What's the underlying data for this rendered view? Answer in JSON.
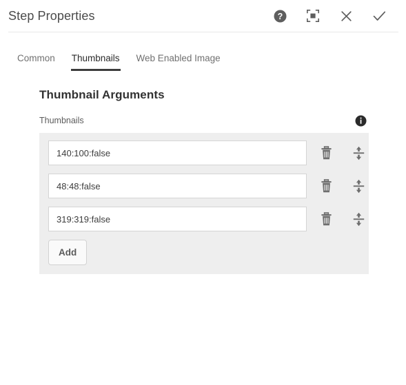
{
  "header": {
    "title": "Step Properties",
    "actions": [
      {
        "name": "help-icon",
        "label": "Help"
      },
      {
        "name": "fullscreen-icon",
        "label": "Fullscreen"
      },
      {
        "name": "close-icon",
        "label": "Close"
      },
      {
        "name": "confirm-check-icon",
        "label": "Done"
      }
    ]
  },
  "tabs": [
    {
      "label": "Common",
      "active": false
    },
    {
      "label": "Thumbnails",
      "active": true
    },
    {
      "label": "Web Enabled Image",
      "active": false
    }
  ],
  "main": {
    "section_title": "Thumbnail Arguments",
    "field": {
      "label": "Thumbnails",
      "info_icon": "info-icon",
      "rows": [
        {
          "value": "140:100:false",
          "delete_icon": "trash-icon",
          "drag_icon": "drag-handle-icon"
        },
        {
          "value": "48:48:false",
          "delete_icon": "trash-icon",
          "drag_icon": "drag-handle-icon"
        },
        {
          "value": "319:319:false",
          "delete_icon": "trash-icon",
          "drag_icon": "drag-handle-icon"
        }
      ],
      "add_label": "Add"
    }
  },
  "colors": {
    "panel_bg": "#eeeeee",
    "accent_underline": "#3c3c3c",
    "icon_gray": "#707070",
    "text_dark": "#323232"
  }
}
